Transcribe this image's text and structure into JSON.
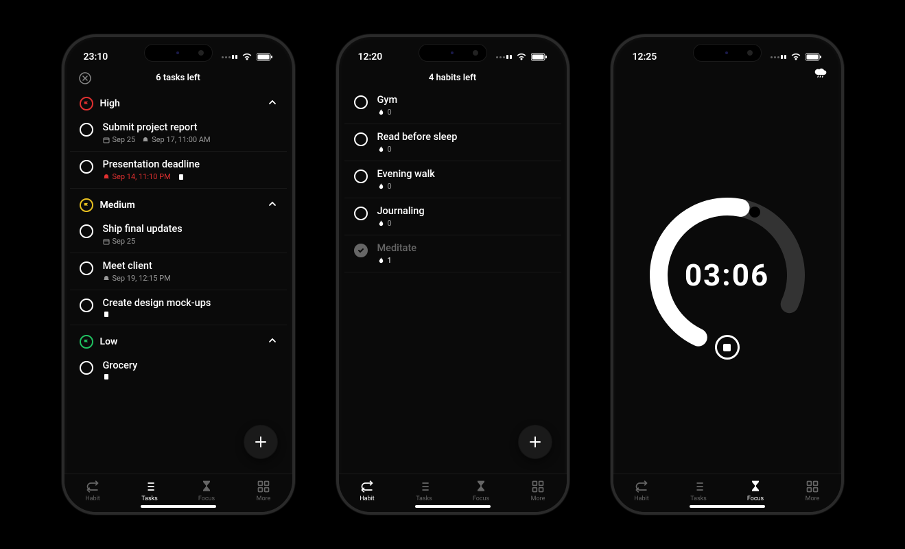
{
  "tasks_phone": {
    "time": "23:10",
    "header_title": "6 tasks left",
    "sections": {
      "high": {
        "label": "High"
      },
      "medium": {
        "label": "Medium"
      },
      "low": {
        "label": "Low"
      }
    },
    "tasks": {
      "t1": {
        "title": "Submit project report",
        "date": "Sep 25",
        "reminder": "Sep 17, 11:00 AM"
      },
      "t2": {
        "title": "Presentation deadline",
        "overdue": "Sep 14, 11:10 PM"
      },
      "t3": {
        "title": "Ship final updates",
        "date": "Sep 25"
      },
      "t4": {
        "title": "Meet client",
        "reminder": "Sep 19, 12:15 PM"
      },
      "t5": {
        "title": "Create design mock-ups"
      },
      "t6": {
        "title": "Grocery"
      }
    }
  },
  "habits_phone": {
    "time": "12:20",
    "header_title": "4 habits left",
    "habits": {
      "h1": {
        "title": "Gym",
        "streak": "0"
      },
      "h2": {
        "title": "Read before sleep",
        "streak": "0"
      },
      "h3": {
        "title": "Evening walk",
        "streak": "0"
      },
      "h4": {
        "title": "Journaling",
        "streak": "0"
      },
      "h5": {
        "title": "Meditate",
        "streak": "1"
      }
    }
  },
  "focus_phone": {
    "time": "12:25",
    "timer": "03:06"
  },
  "tabbar": {
    "habit": "Habit",
    "tasks": "Tasks",
    "focus": "Focus",
    "more": "More"
  }
}
